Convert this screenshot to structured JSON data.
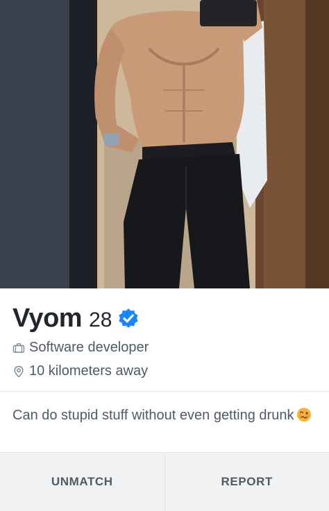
{
  "profile": {
    "name": "Vyom",
    "age": "28",
    "job": "Software developer",
    "distance": "10 kilometers away",
    "bio": "Can do stupid stuff without even getting drunk",
    "verified_color": "#1786ff"
  },
  "photo": {
    "icon": "profile-photo"
  },
  "actions": {
    "unmatch_label": "UNMATCH",
    "report_label": "REPORT"
  }
}
